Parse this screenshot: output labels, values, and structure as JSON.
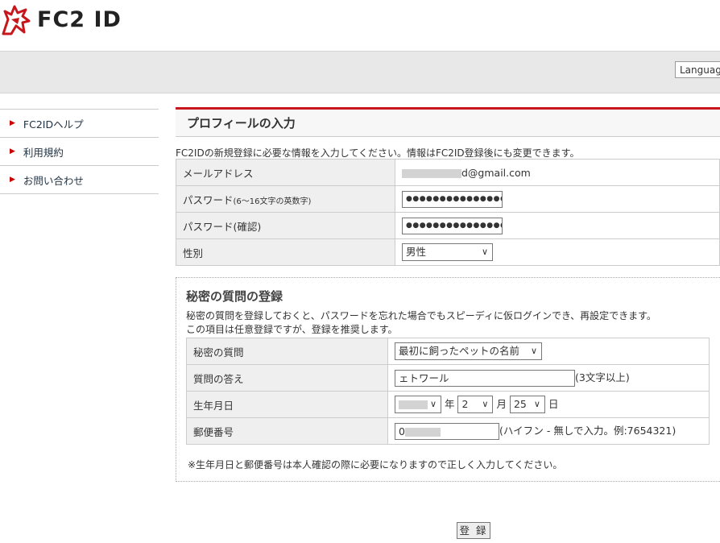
{
  "header": {
    "logo_text": "FC2 ID",
    "language_label": "Languag"
  },
  "sidebar": {
    "items": [
      {
        "label": "FC2IDヘルプ"
      },
      {
        "label": "利用規約"
      },
      {
        "label": "お問い合わせ"
      }
    ]
  },
  "profile": {
    "title": "プロフィールの入力",
    "intro": "FC2IDの新規登録に必要な情報を入力してください。情報はFC2ID登録後にも変更できます。",
    "email_label": "メールアドレス",
    "email_value": "d@gmail.com",
    "password_label": "パスワード",
    "password_hint": "(6～16文字の英数字)",
    "password_value": "●●●●●●●●●●●●●●●",
    "password_confirm_label": "パスワード(確認)",
    "password_confirm_value": "●●●●●●●●●●●●●●●",
    "gender_label": "性別",
    "gender_value": "男性"
  },
  "secret": {
    "title": "秘密の質問の登録",
    "desc1": "秘密の質問を登録しておくと、パスワードを忘れた場合でもスピーディに仮ログインでき、再設定できます。",
    "desc2": "この項目は任意登録ですが、登録を推奨します。",
    "question_label": "秘密の質問",
    "question_value": "最初に飼ったペットの名前",
    "answer_label": "質問の答え",
    "answer_value": "ェトワール",
    "answer_hint": "(3文字以上)",
    "birth_label": "生年月日",
    "year_suffix": "年",
    "month_value": "2",
    "month_suffix": "月",
    "day_value": "25",
    "day_suffix": "日",
    "zip_label": "郵便番号",
    "zip_value": "0",
    "zip_hint": "(ハイフン - 無しで入力。例:7654321)",
    "note": "※生年月日と郵便番号は本人確認の際に必要になりますので正しく入力してください。"
  },
  "submit_label": "登 録",
  "colors": {
    "accent": "#c8161d",
    "label_bg": "#efefef",
    "band_bg": "#e8e8e8"
  },
  "icons": {
    "logo": "fc2-horse-logo-icon",
    "bullet": "triangle-right-icon",
    "dropdown": "chevron-down-icon"
  }
}
